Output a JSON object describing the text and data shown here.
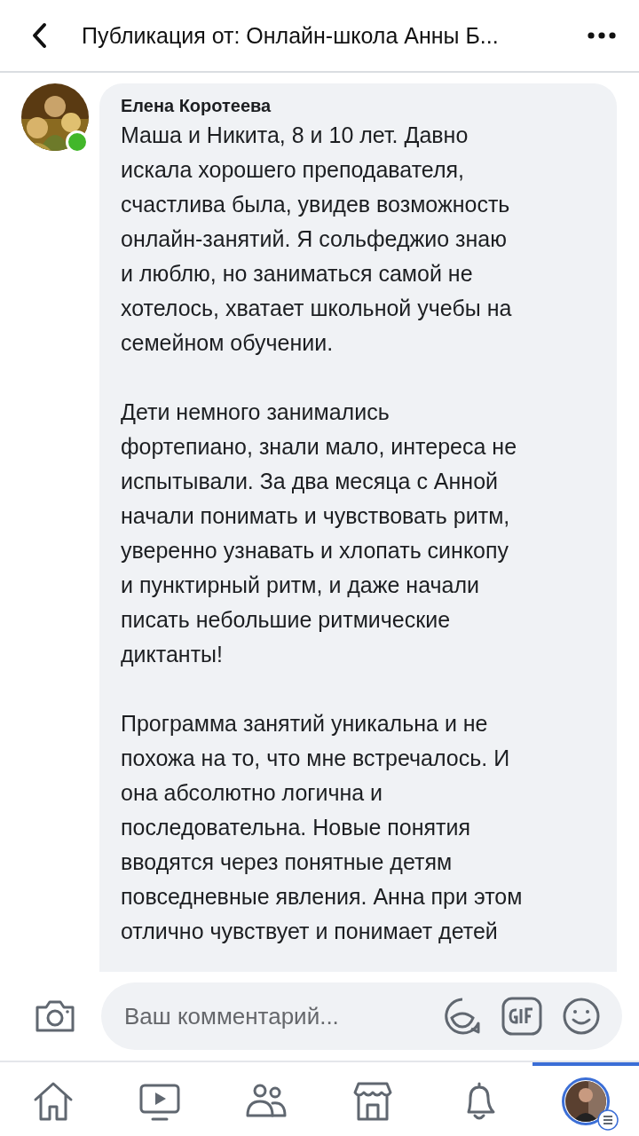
{
  "header": {
    "title": "Публикация от: Онлайн-школа Анны Б..."
  },
  "comment": {
    "author": "Елена Коротеева",
    "online": true,
    "avatar": {
      "kind": "picture"
    },
    "paragraphs": [
      [
        "Маша и Никита, 8 и 10 лет. Давно",
        "искала хорошего преподавателя,",
        "счастлива была, увидев возможность",
        "онлайн-занятий. Я сольфеджио знаю",
        "и люблю, но заниматься самой не",
        "хотелось, хватает школьной учебы на",
        "семейном обучении."
      ],
      [
        "Дети немного занимались",
        "фортепиано, знали мало, интереса не",
        "испытывали. За два месяца с Анной",
        "начали понимать и чувствовать ритм,",
        "уверенно узнавать и хлопать синкопу",
        "и пунктирный ритм, и даже начали",
        "писать небольшие ритмические",
        "диктанты!"
      ],
      [
        "Программа занятий уникальна и не",
        "похожа на то, что мне встречалось. И",
        "она абсолютно логична и",
        "последовательна. Новые понятия",
        "вводятся через понятные детям",
        "повседневные явления. Анна при этом",
        "отлично чувствует и понимает детей"
      ]
    ]
  },
  "composer": {
    "placeholder": "Ваш комментарий..."
  },
  "tabs": [
    {
      "kind": "home",
      "selected": false
    },
    {
      "kind": "video",
      "selected": false
    },
    {
      "kind": "groups",
      "selected": false
    },
    {
      "kind": "market",
      "selected": false
    },
    {
      "kind": "bell",
      "selected": false
    },
    {
      "kind": "profile",
      "selected": true
    }
  ]
}
